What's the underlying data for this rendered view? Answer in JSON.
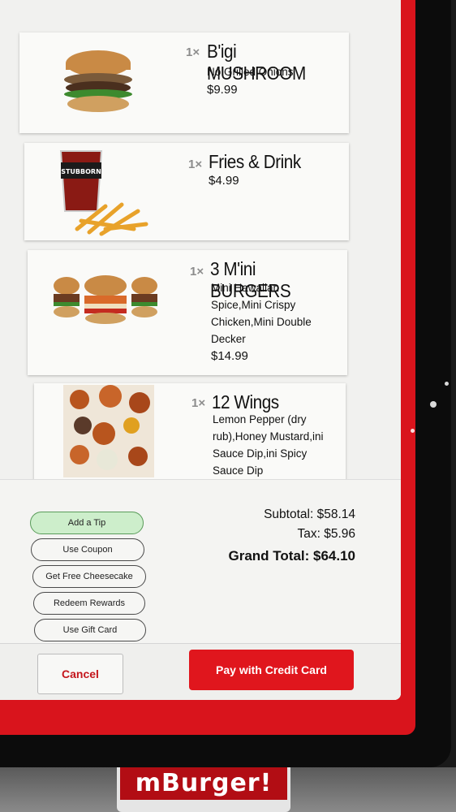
{
  "items": [
    {
      "qty": "1×",
      "name": "B'igi MUSHROOM",
      "desc": [
        "No Grilled Onions"
      ],
      "price": "$9.99",
      "icon": "burger-mushroom-image"
    },
    {
      "qty": "1×",
      "name": "Fries & Drink",
      "desc": [],
      "price": "$4.99",
      "icon": "fries-drink-image"
    },
    {
      "qty": "1×",
      "name": "3 M'ini BURGERS",
      "desc": [
        "Mini Hawaiian",
        "Spice,Mini Crispy",
        "Chicken,Mini Double",
        "Decker"
      ],
      "price": "$14.99",
      "icon": "mini-burgers-image"
    },
    {
      "qty": "1×",
      "name": "12 Wings",
      "desc": [
        "Lemon Pepper (dry",
        "rub),Honey Mustard,ini",
        "Sauce Dip,ini Spicy",
        "Sauce Dip"
      ],
      "price": "",
      "icon": "wings-image"
    }
  ],
  "cup_logo": "STUBBORN",
  "actions": {
    "tip": "Add a Tip",
    "coupon": "Use Coupon",
    "cheesecake": "Get Free Cheesecake",
    "rewards": "Redeem Rewards",
    "gift": "Use Gift Card"
  },
  "totals": {
    "subtotal": "Subtotal: $58.14",
    "tax": "Tax: $5.96",
    "grand": "Grand Total: $64.10"
  },
  "buttons": {
    "cancel": "Cancel",
    "pay": "Pay with Credit Card"
  },
  "brand_sign": "mBurger!",
  "colors": {
    "accent": "#e0161d",
    "tip_bg": "#cdeecb",
    "frame": "#d9141c"
  }
}
